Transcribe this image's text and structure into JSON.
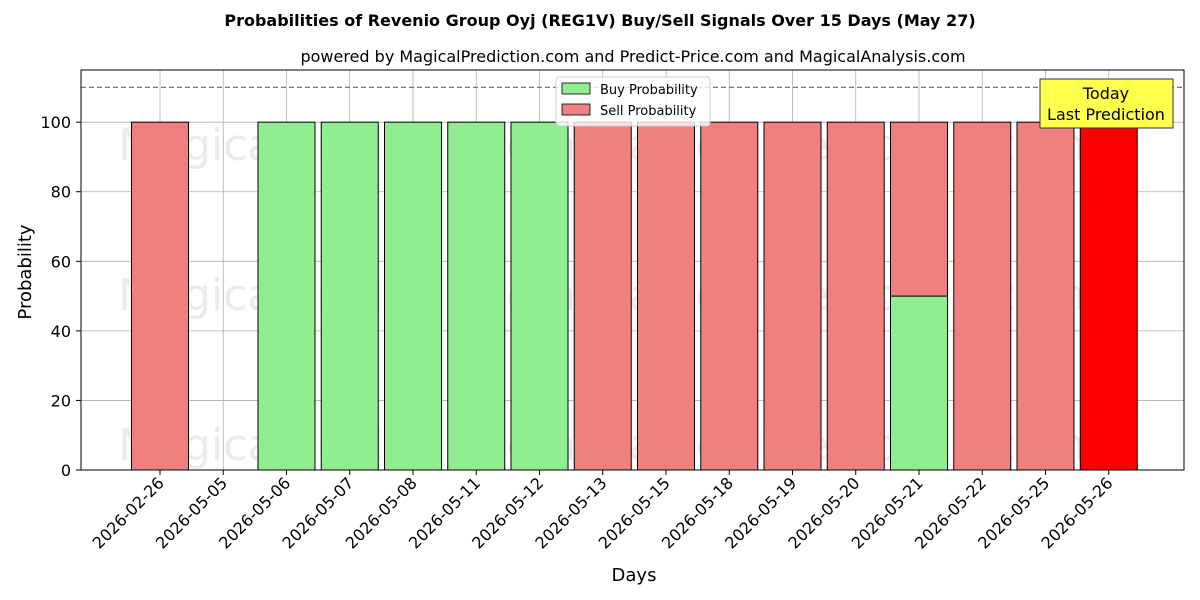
{
  "chart_data": {
    "type": "bar",
    "stacked": true,
    "title": "Probabilities of Revenio Group Oyj (REG1V) Buy/Sell Signals Over 15 Days (May 27)",
    "subtitle": "powered by MagicalPrediction.com and Predict-Price.com and MagicalAnalysis.com",
    "xlabel": "Days",
    "ylabel": "Probability",
    "ylim": [
      0,
      115
    ],
    "yticks": [
      0,
      20,
      40,
      60,
      80,
      100
    ],
    "reference_line": 110,
    "grid": true,
    "legend_position": "top-center",
    "categories": [
      "2026-02-26",
      "2026-05-05",
      "2026-05-06",
      "2026-05-07",
      "2026-05-08",
      "2026-05-11",
      "2026-05-12",
      "2026-05-13",
      "2026-05-15",
      "2026-05-18",
      "2026-05-19",
      "2026-05-20",
      "2026-05-21",
      "2026-05-22",
      "2026-05-25",
      "2026-05-26"
    ],
    "bar_slots": [
      0,
      2,
      3,
      4,
      5,
      6,
      7,
      8,
      9,
      10,
      11,
      12,
      13,
      14,
      15
    ],
    "series": [
      {
        "name": "Buy Probability",
        "color": "#90ee90",
        "values": [
          0,
          100,
          100,
          100,
          100,
          100,
          0,
          0,
          0,
          0,
          0,
          50,
          0,
          0,
          0
        ]
      },
      {
        "name": "Sell Probability",
        "color": "#f08080",
        "values": [
          100,
          0,
          0,
          0,
          0,
          0,
          100,
          100,
          100,
          100,
          100,
          50,
          100,
          100,
          100
        ]
      }
    ],
    "highlight": {
      "index": 14,
      "color": "#ff0000"
    },
    "annotation": {
      "line1": "Today",
      "line2": "Last Prediction",
      "bg": "#ffff4d"
    },
    "watermarks": [
      "MagicalAnalysis.com",
      "MagicalPrediction.com"
    ]
  }
}
